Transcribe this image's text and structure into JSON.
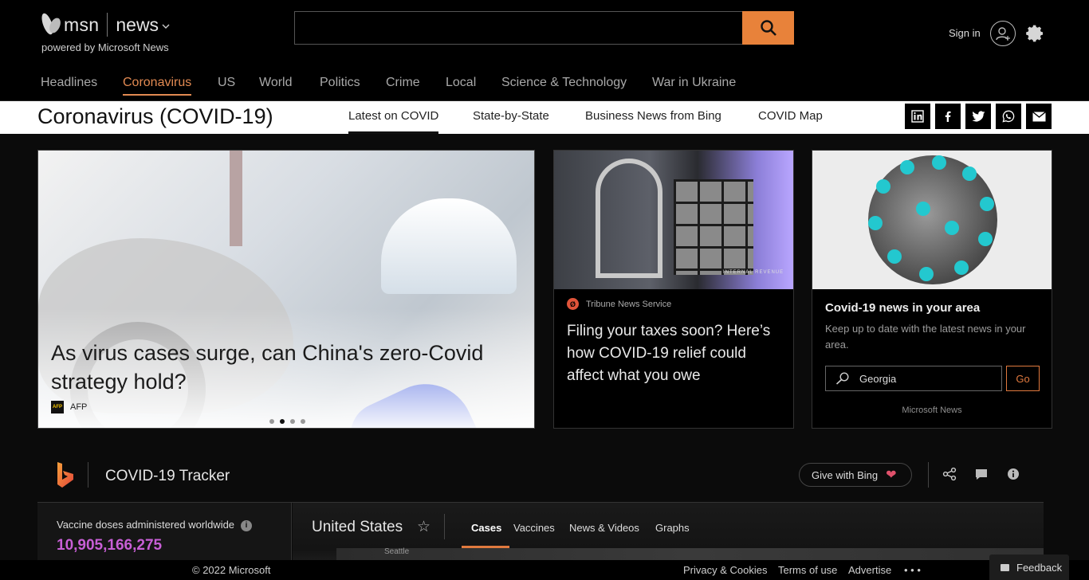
{
  "header": {
    "brand": "msn",
    "section": "news",
    "powered_by": "powered by Microsoft News",
    "search_value": "",
    "sign_in": "Sign in"
  },
  "nav": {
    "items": [
      "Headlines",
      "Coronavirus",
      "US",
      "World",
      "Politics",
      "Crime",
      "Local",
      "Science & Technology",
      "War in Ukraine"
    ],
    "active": "Coronavirus"
  },
  "topic": {
    "title": "Coronavirus (COVID-19)",
    "tabs": [
      "Latest on COVID",
      "State-by-State",
      "Business News from Bing",
      "COVID Map"
    ],
    "active_tab": "Latest on COVID",
    "share_icons": [
      "linkedin-icon",
      "facebook-icon",
      "twitter-icon",
      "whatsapp-icon",
      "mail-icon"
    ]
  },
  "hero": {
    "title": "As virus cases surge, can China's zero-Covid strategy hold?",
    "source": "AFP",
    "source_logo": "AFP",
    "slide_count": 4,
    "active_slide": 2
  },
  "card2": {
    "source": "Tribune News Service",
    "title": "Filing your taxes soon? Here’s how COVID-19 relief could affect what you owe",
    "image_text": "INTERNAL REVENUE"
  },
  "card3": {
    "title": "Covid-19 news in your area",
    "description": "Keep up to date with the latest news in your area.",
    "location_value": "Georgia",
    "go_label": "Go",
    "footer": "Microsoft News"
  },
  "tracker": {
    "title": "COVID-19 Tracker",
    "give_label": "Give with Bing",
    "vaccine_label": "Vaccine doses administered worldwide",
    "vaccine_value": "10,905,166,275",
    "country": "United States",
    "tabs": [
      "Cases",
      "Vaccines",
      "News & Videos",
      "Graphs"
    ],
    "active_tab": "Cases",
    "map_label": "Seattle"
  },
  "footer": {
    "copyright": "© 2022 Microsoft",
    "links": [
      "Privacy & Cookies",
      "Terms of use",
      "Advertise",
      "• • •"
    ],
    "feedback": "Feedback"
  },
  "colors": {
    "accent": "#e28a52",
    "search_button": "#e8823a",
    "vaccine_value": "#c85fd6"
  }
}
